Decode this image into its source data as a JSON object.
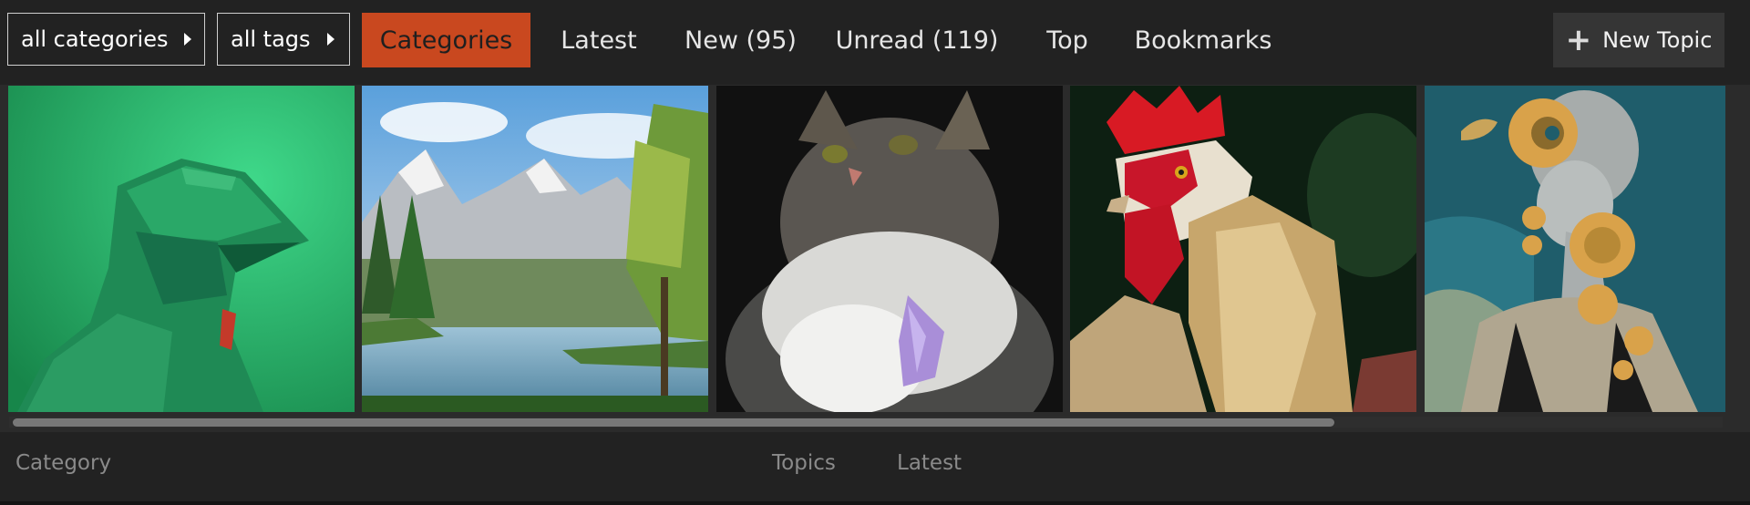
{
  "nav": {
    "categories_dropdown": "all categories",
    "tags_dropdown": "all tags",
    "tabs": [
      {
        "label": "Categories",
        "active": true
      },
      {
        "label": "Latest",
        "active": false
      },
      {
        "label": "New (95)",
        "active": false
      },
      {
        "label": "Unread (119)",
        "active": false
      },
      {
        "label": "Top",
        "active": false
      },
      {
        "label": "Bookmarks",
        "active": false
      }
    ],
    "new_topic_label": "New Topic"
  },
  "gallery": {
    "images": [
      {
        "subject": "green-robot-knight"
      },
      {
        "subject": "mountain-lake-landscape"
      },
      {
        "subject": "fluffy-cat-with-flower"
      },
      {
        "subject": "rooster-portrait"
      },
      {
        "subject": "bald-woman-with-gold-discs"
      }
    ]
  },
  "table_header": {
    "category": "Category",
    "topics": "Topics",
    "latest": "Latest"
  },
  "colors": {
    "background": "#222222",
    "active_tab": "#c9481f",
    "new_topic_bg": "#353535"
  }
}
